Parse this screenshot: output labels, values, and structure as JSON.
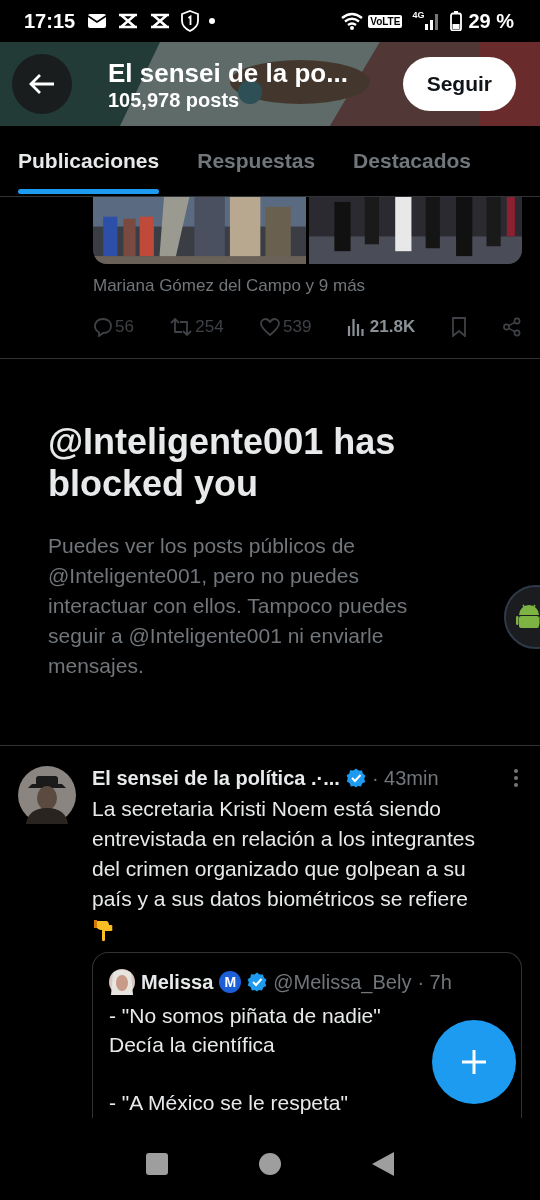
{
  "status_bar": {
    "time": "17:15",
    "volte": "VoLTE",
    "network": "4G",
    "battery": "29 %"
  },
  "header": {
    "title": "El sensei de la po...",
    "posts": "105,978 posts",
    "follow_button": "Seguir"
  },
  "tabs": [
    {
      "label": "Publicaciones",
      "selected": true
    },
    {
      "label": "Respuestas",
      "selected": false
    },
    {
      "label": "Destacados",
      "selected": false
    }
  ],
  "previous_post": {
    "attribution": "Mariana Gómez del Campo y 9 más",
    "actions": [
      {
        "kind": "reply",
        "count": "56"
      },
      {
        "kind": "repost",
        "count": "254"
      },
      {
        "kind": "like",
        "count": "539"
      },
      {
        "kind": "views",
        "count": "21.8K"
      },
      {
        "kind": "bookmark"
      },
      {
        "kind": "share"
      }
    ]
  },
  "blocked": {
    "title": "@Inteligente001 has blocked you",
    "message": "Puedes ver los posts públicos de @Inteligente001, pero no puedes interactuar con ellos. Tampoco puedes seguir a @Inteligente001 ni enviarle mensajes."
  },
  "tweet": {
    "author": "El sensei de la política .·...",
    "verified": true,
    "time": "· 43min",
    "text": "La secretaria Kristi Noem está siendo entrevistada en relación a los integrantes del crimen organizado que golpean a su país y a sus datos biométricos se refiere",
    "quote": {
      "author": "Melissa",
      "badge": "M",
      "verified": true,
      "handle": "@Melissa_Bely",
      "time": "· 7h",
      "text": "- \"No somos piñata de nadie\"\nDecía la científica\n\n- \"A México se le respeta\""
    }
  }
}
